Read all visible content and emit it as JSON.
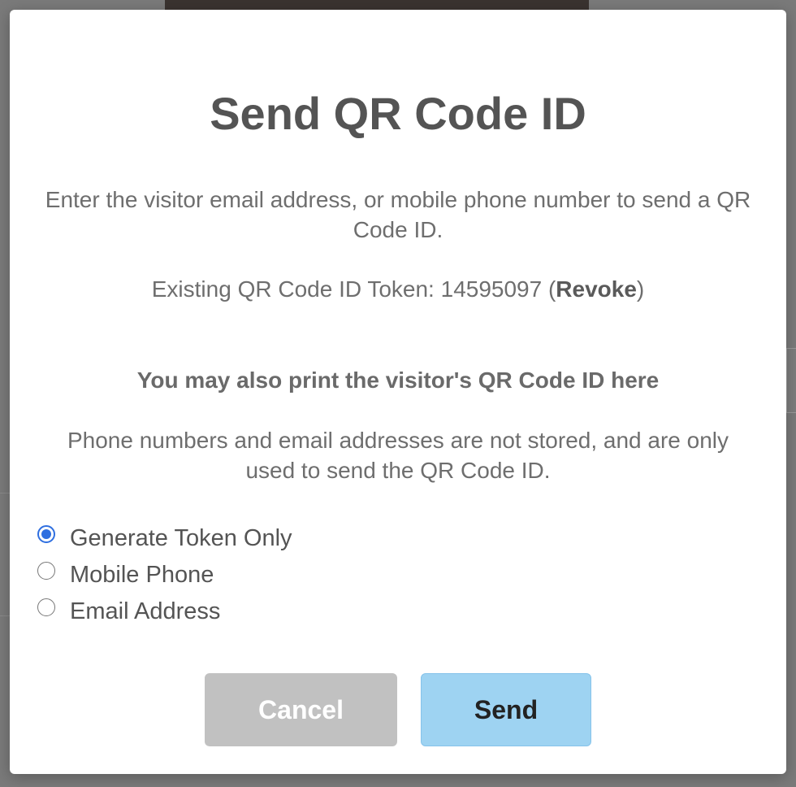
{
  "modal": {
    "title": "Send QR Code ID",
    "description_line": "Enter the visitor email address, or mobile phone number to send a QR Code ID.",
    "token_prefix": "Existing QR Code ID Token: 14595097 (",
    "token_action": "Revoke",
    "token_suffix": ")",
    "print_note": "You may also print the visitor's QR Code ID here",
    "privacy_note": "Phone numbers and email addresses are not stored, and are only used to send the QR Code ID.",
    "options": [
      {
        "label": "Generate Token Only",
        "checked": true
      },
      {
        "label": "Mobile Phone",
        "checked": false
      },
      {
        "label": "Email Address",
        "checked": false
      }
    ],
    "cancel_label": "Cancel",
    "send_label": "Send"
  },
  "colors": {
    "radio_accent": "#2f6fe0",
    "send_button": "#9ed3f2",
    "cancel_button": "#c1c1c1"
  }
}
